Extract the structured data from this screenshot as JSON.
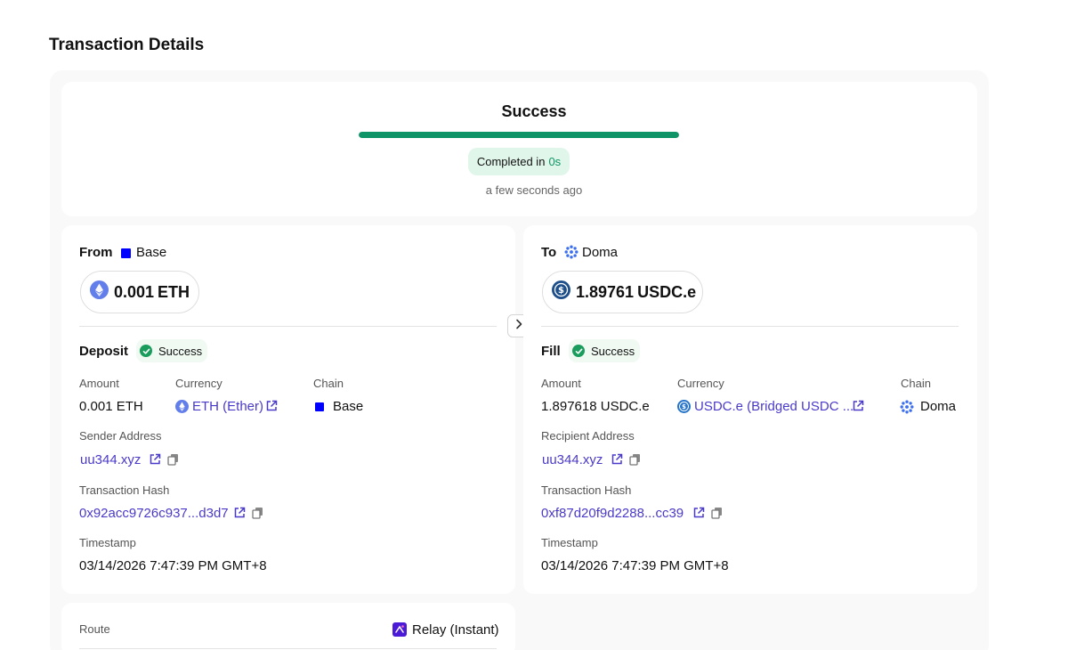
{
  "page": {
    "title": "Transaction Details"
  },
  "status": {
    "title": "Success",
    "progress": 1.0,
    "completed_label": "Completed in",
    "duration": "0s",
    "time_ago": "a few seconds ago",
    "accent_color": "#0f9467"
  },
  "from": {
    "label": "From",
    "chain": "Base",
    "chain_icon": "base-square-icon",
    "amount": "0.001",
    "symbol": "ETH",
    "token_icon": "eth-icon",
    "section_title": "Deposit",
    "section_status": "Success",
    "fields": {
      "amount_label": "Amount",
      "amount_value": "0.001 ETH",
      "currency_label": "Currency",
      "currency_value": "ETH (Ether)",
      "chain_label": "Chain",
      "chain_value": "Base",
      "address_label": "Sender Address",
      "address_value": "uu344.xyz",
      "hash_label": "Transaction Hash",
      "hash_value": "0x92acc9726c937...d3d7",
      "timestamp_label": "Timestamp",
      "timestamp_value": "03/14/2026 7:47:39 PM GMT+8"
    }
  },
  "to": {
    "label": "To",
    "chain": "Doma",
    "chain_icon": "doma-icon",
    "amount": "1.89761",
    "symbol": "USDC.e",
    "token_icon": "usdc-icon",
    "section_title": "Fill",
    "section_status": "Success",
    "fields": {
      "amount_label": "Amount",
      "amount_value": "1.897618 USDC.e",
      "currency_label": "Currency",
      "currency_value": "USDC.e (Bridged USDC ...",
      "chain_label": "Chain",
      "chain_value": "Doma",
      "address_label": "Recipient Address",
      "address_value": "uu344.xyz",
      "hash_label": "Transaction Hash",
      "hash_value": "0xf87d20f9d2288...cc39",
      "timestamp_label": "Timestamp",
      "timestamp_value": "03/14/2026 7:47:39 PM GMT+8"
    }
  },
  "route": {
    "label": "Route",
    "value": "Relay (Instant)",
    "icon": "relay-icon"
  },
  "colors": {
    "link": "#4a3aca",
    "success": "#1a9c5d",
    "base_blue": "#0000ff",
    "relay_purple": "#4b1ad6"
  }
}
